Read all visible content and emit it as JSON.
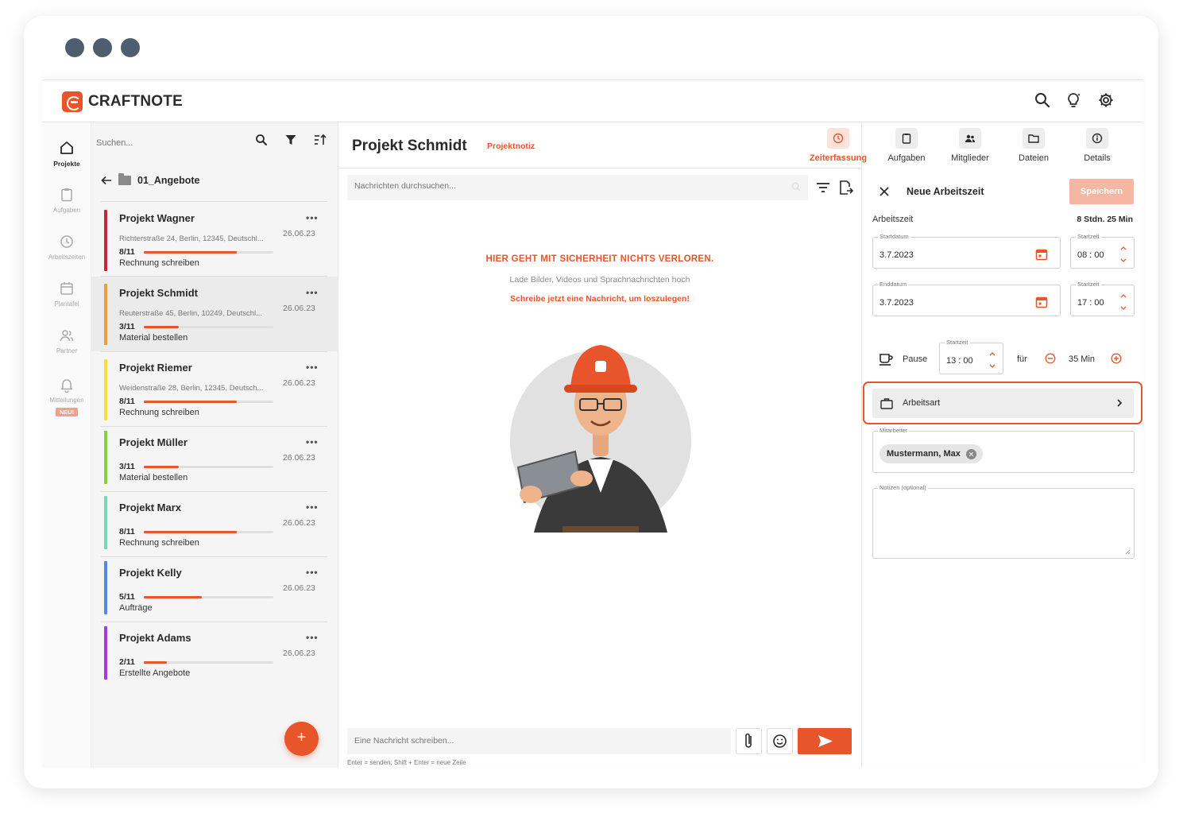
{
  "brand": {
    "name": "CRAFTNOTE",
    "accent": "#e8552a"
  },
  "topbar": {
    "icons": [
      "search-icon",
      "lightbulb-icon",
      "gear-icon"
    ]
  },
  "rail": {
    "items": [
      {
        "label": "Projekte",
        "icon": "home-icon",
        "active": true
      },
      {
        "label": "Aufgaben",
        "icon": "clipboard-icon"
      },
      {
        "label": "Arbeitszeiten",
        "icon": "clock-icon"
      },
      {
        "label": "Plantafel",
        "icon": "calendar-icon"
      },
      {
        "label": "Partner",
        "icon": "people-icon"
      },
      {
        "label": "Mitteilungen",
        "icon": "bell-icon",
        "badge": "NEU!"
      }
    ]
  },
  "project_list": {
    "search_placeholder": "Suchen...",
    "folder": "01_Angebote",
    "projects": [
      {
        "title": "Projekt Wagner",
        "address": "Richterstraße 24, Berlin, 12345, Deutschl...",
        "date": "26.06.23",
        "count": "8/11",
        "progress": 0.72,
        "task": "Rechnung schreiben",
        "color": "#c0283c"
      },
      {
        "title": "Projekt Schmidt",
        "address": "Reuterstraße 45, Berlin, 10249, Deutschl...",
        "date": "26.06.23",
        "count": "3/11",
        "progress": 0.27,
        "task": "Material bestellen",
        "color": "#e4a23a",
        "selected": true
      },
      {
        "title": "Projekt Riemer",
        "address": "Weidenstraße 28, Berlin, 12345, Deutsch...",
        "date": "26.06.23",
        "count": "8/11",
        "progress": 0.72,
        "task": "Rechnung schreiben",
        "color": "#f2de3c"
      },
      {
        "title": "Projekt Müller",
        "address": "",
        "date": "26.06.23",
        "count": "3/11",
        "progress": 0.27,
        "task": "Material bestellen",
        "color": "#8ccf3e"
      },
      {
        "title": "Projekt Marx",
        "address": "",
        "date": "26.06.23",
        "count": "8/11",
        "progress": 0.72,
        "task": "Rechnung schreiben",
        "color": "#7fd3b6"
      },
      {
        "title": "Projekt Kelly",
        "address": "",
        "date": "26.06.23",
        "count": "5/11",
        "progress": 0.45,
        "task": "Aufträge",
        "color": "#5b86e0"
      },
      {
        "title": "Projekt Adams",
        "address": "",
        "date": "26.06.23",
        "count": "2/11",
        "progress": 0.18,
        "task": "Erstellte Angebote",
        "color": "#a03cd8"
      }
    ],
    "add_label": "+"
  },
  "center": {
    "title": "Projekt Schmidt",
    "subtitle": "Projektnotiz",
    "search_placeholder": "Nachrichten durchsuchen...",
    "empty_title": "HIER GEHT MIT SICHERHEIT NICHTS VERLOREN.",
    "empty_sub": "Lade Bilder, Videos und Sprachnachrichten hoch",
    "empty_cta": "Schreibe jetzt eine Nachricht, um loszulegen!",
    "composer_placeholder": "Eine Nachricht schreiben...",
    "hint": "Enter = senden; Shift + Enter = neue Zeile"
  },
  "tabs": [
    {
      "label": "Zeiterfassung",
      "icon": "clock-icon",
      "active": true
    },
    {
      "label": "Aufgaben",
      "icon": "clipboard-icon"
    },
    {
      "label": "Mitglieder",
      "icon": "members-icon"
    },
    {
      "label": "Dateien",
      "icon": "folder-icon"
    },
    {
      "label": "Details",
      "icon": "info-icon"
    }
  ],
  "time_form": {
    "title": "Neue Arbeitszeit",
    "save_label": "Speichern",
    "section_label": "Arbeitszeit",
    "total": "8 Stdn. 25 Min",
    "start_date_label": "Startdatum",
    "start_date": "3.7.2023",
    "start_time_label": "Startzeit",
    "start_time": "08 : 00",
    "end_date_label": "Enddatum",
    "end_date": "3.7.2023",
    "end_time_label": "Startzeit",
    "end_time": "17 : 00",
    "pause_label": "Pause",
    "pause_start_label": "Startzeit",
    "pause_start": "13 : 00",
    "for_label": "für",
    "pause_duration": "35 Min",
    "work_type_label": "Arbeitsart",
    "employee_label": "Mitarbeiter",
    "employee": "Mustermann, Max",
    "notes_label": "Notizen (optional)"
  }
}
